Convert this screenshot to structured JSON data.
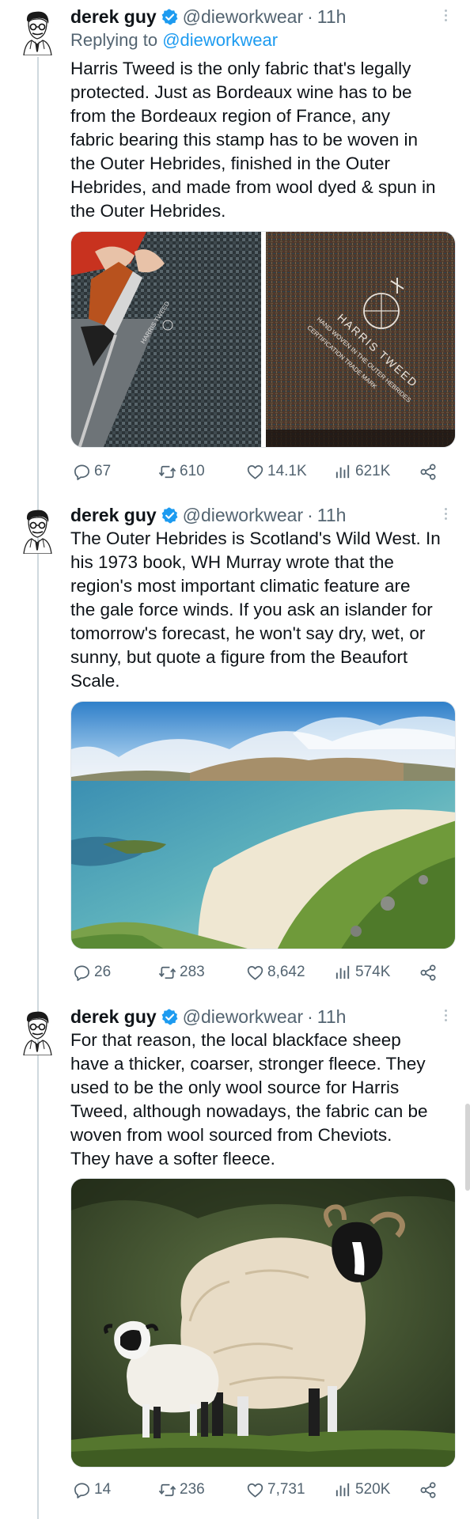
{
  "tweets": [
    {
      "name": "derek guy",
      "handle": "@dieworkwear",
      "separator": "·",
      "time": "11h",
      "reply_prefix": "Replying to",
      "reply_mention": "@dieworkwear",
      "text_lines": [
        "Harris Tweed is the only fabric that's legally",
        "protected. Just as Bordeaux wine has to be",
        "from the Bordeaux region of France, any",
        "fabric bearing this stamp has to be woven in",
        "the Outer Hebrides, finished in the Outer",
        "Hebrides, and made from wool dyed & spun in",
        "the Outer Hebrides."
      ],
      "stamp_text": {
        "brand": "HARRIS TWEED",
        "line1": "HAND WOVEN IN THE OUTER HEBRIDES",
        "line2": "CERTIFICATION TRADE MARK"
      },
      "stats": {
        "replies": "67",
        "reposts": "610",
        "likes": "14.1K",
        "views": "621K"
      }
    },
    {
      "name": "derek guy",
      "handle": "@dieworkwear",
      "separator": "·",
      "time": "11h",
      "text_lines": [
        "The Outer Hebrides is Scotland's Wild West. In",
        "his 1973 book, WH Murray wrote that the",
        "region's most important  climatic feature are",
        "the gale force winds. If you ask an islander for",
        "tomorrow's forecast, he won't say dry, wet, or",
        "sunny, but quote a figure from the Beaufort",
        "Scale."
      ],
      "stats": {
        "replies": "26",
        "reposts": "283",
        "likes": "8,642",
        "views": "574K"
      }
    },
    {
      "name": "derek guy",
      "handle": "@dieworkwear",
      "separator": "·",
      "time": "11h",
      "text_lines": [
        "For that reason, the local blackface sheep",
        "have a thicker, coarser, stronger fleece. They",
        "used to be the only wool source for Harris",
        "Tweed, although nowadays, the fabric can be",
        "woven from wool sourced from Cheviots.",
        "They have a softer fleece."
      ],
      "stats": {
        "replies": "14",
        "reposts": "236",
        "likes": "7,731",
        "views": "520K"
      }
    }
  ],
  "colors": {
    "text": "#0f1419",
    "secondary": "#536471",
    "accent": "#1d9bf0",
    "thread_line": "#cfd9de"
  },
  "icons": [
    "reply-icon",
    "repost-icon",
    "like-icon",
    "views-icon",
    "share-icon",
    "verified-badge-icon",
    "more-icon"
  ]
}
